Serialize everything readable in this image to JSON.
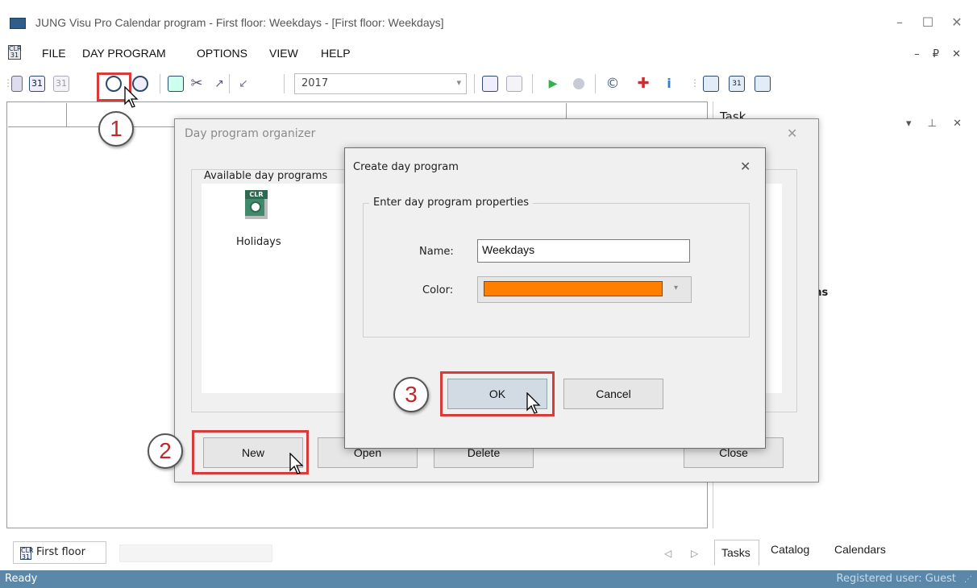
{
  "window": {
    "title": "JUNG Visu Pro Calendar program - First floor: Weekdays - [First floor: Weekdays]",
    "min": "–",
    "max": "☐",
    "close": "✕",
    "mdi_controls": "– ₽ ✕"
  },
  "menu": [
    "FILE",
    "DAY PROGRAM",
    "OPTIONS",
    "VIEW",
    "HELP"
  ],
  "toolbar": {
    "year": "2017",
    "icons": [
      "new-calendar-icon",
      "calendar-31-icon",
      "calendar-faded-icon",
      "day-program-new-icon",
      "day-program-open-icon",
      "assign-icon",
      "cut-icon",
      "move-icon",
      "export-icon",
      "calendar-table-icon",
      "calendar-table-faded-icon",
      "play-icon",
      "stop-icon",
      "copyright-icon",
      "plus-red-icon",
      "info-icon",
      "view-one-icon",
      "view-two-icon",
      "view-three-icon"
    ]
  },
  "tasks_panel": {
    "title": "Task",
    "controls": "▾ ⊥ ✕",
    "fragment": "ms"
  },
  "tabs": {
    "document_tab": "First floor",
    "right_tabs": [
      "Tasks",
      "Catalog",
      "Calendars"
    ],
    "nav": "◁ ▷"
  },
  "status": {
    "left": "Ready",
    "right": "Registered user: Guest"
  },
  "organizer": {
    "title": "Day program organizer",
    "close": "✕",
    "group_label": "Available day programs",
    "item": {
      "label": "Holidays",
      "badge": "CLR"
    },
    "buttons": {
      "new": "New",
      "open": "Open",
      "delete": "Delete",
      "close": "Close"
    }
  },
  "create_dialog": {
    "title": "Create day program",
    "close": "✕",
    "group_label": "Enter day program properties",
    "name_label": "Name:",
    "name_value": "Weekdays",
    "color_label": "Color:",
    "color_value": "#ff8000",
    "ok": "OK",
    "cancel": "Cancel"
  },
  "callouts": [
    "1",
    "2",
    "3"
  ],
  "colors": {
    "status_bar": "#5b88a8",
    "highlight": "#d93a3a",
    "swatch": "#ff8000"
  }
}
